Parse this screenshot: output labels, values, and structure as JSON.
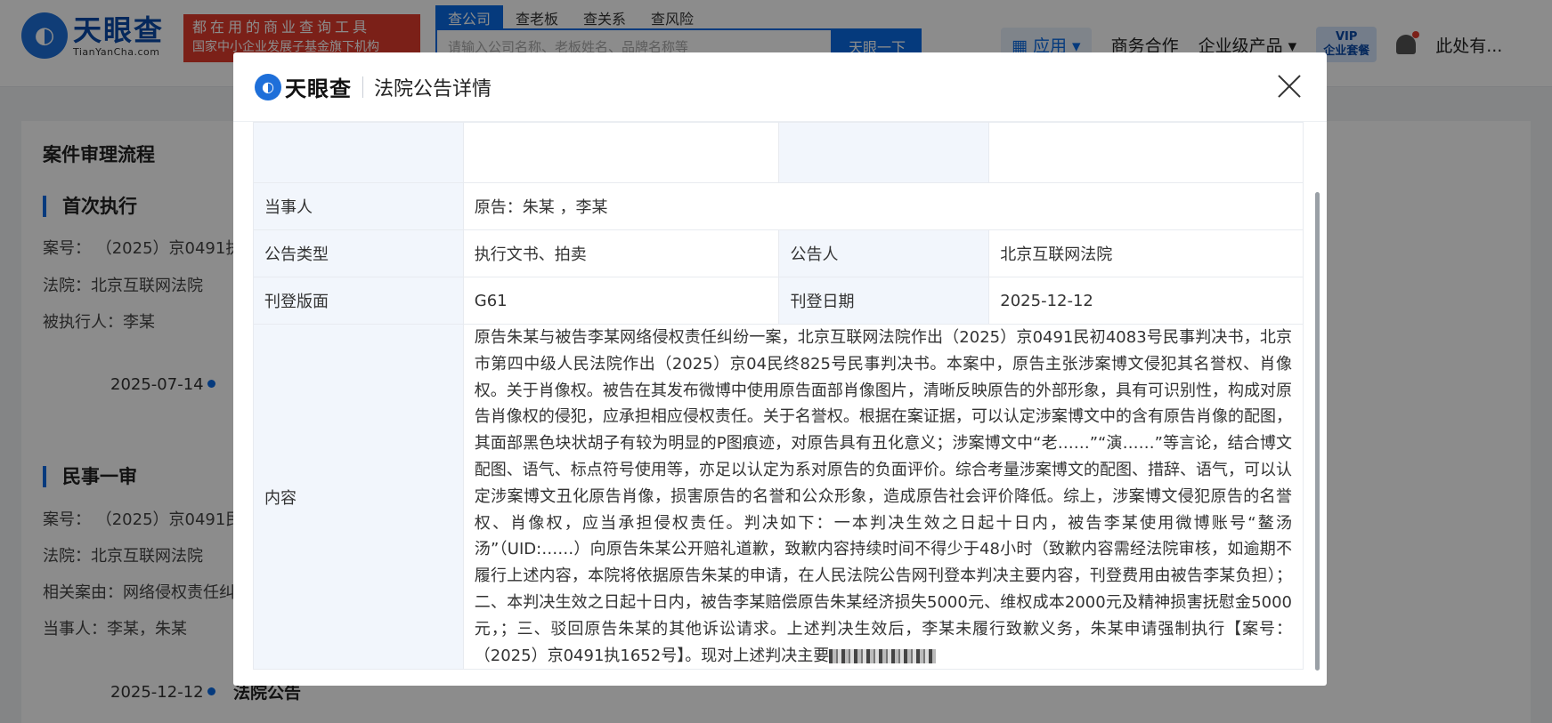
{
  "header": {
    "logo_cn": "天眼查",
    "logo_en": "TianYanCha.com",
    "slogan_line1": "都在用的商业查询工具",
    "slogan_line2": "国家中小企业发展子基金旗下机构",
    "search_tabs": [
      "查公司",
      "查老板",
      "查关系",
      "查风险"
    ],
    "search_placeholder": "请输入公司名称、老板姓名、品牌名称等",
    "search_button": "天眼一下",
    "nav": {
      "app": "应用",
      "business": "商务合作",
      "enterprise": "企业级产品",
      "vip_top": "VIP",
      "vip_bottom": "企业套餐",
      "user": "此处有..."
    }
  },
  "background": {
    "title": "案件审理流程",
    "section1": {
      "title": "首次执行",
      "case_no": "案号： （2025）京0491执",
      "court": "法院：北京互联网法院",
      "executed": "被执行人：李某",
      "date": "2025-07-14"
    },
    "section2": {
      "title": "民事一审",
      "case_no": "案号： （2025）京0491民",
      "court": "法院：北京互联网法院",
      "cause": "相关案由：网络侵权责任纠",
      "parties": "当事人：李某，朱某",
      "date": "2025-12-12",
      "tag": "法院公告"
    }
  },
  "modal": {
    "logo": "天眼查",
    "title": "法院公告详情",
    "rows": {
      "party_label": "当事人",
      "party_value": "原告：朱某 ，李某",
      "type_label": "公告类型",
      "type_value": "执行文书、拍卖",
      "announcer_label": "公告人",
      "announcer_value": "北京互联网法院",
      "page_label": "刊登版面",
      "page_value": "G61",
      "date_label": "刊登日期",
      "date_value": "2025-12-12",
      "content_label": "内容",
      "content_value": "原告朱某与被告李某网络侵权责任纠纷一案，北京互联网法院作出（2025）京0491民初4083号民事判决书，北京市第四中级人民法院作出（2025）京04民终825号民事判决书。本案中，原告主张涉案博文侵犯其名誉权、肖像权。关于肖像权。被告在其发布微博中使用原告面部肖像图片，清晰反映原告的外部形象，具有可识别性，构成对原告肖像权的侵犯，应承担相应侵权责任。关于名誉权。根据在案证据，可以认定涉案博文中的含有原告肖像的配图，其面部黑色块状胡子有较为明显的P图痕迹，对原告具有丑化意义；涉案博文中“老……”“演……”等言论，结合博文配图、语气、标点符号使用等，亦足以认定为系对原告的负面评价。综合考量涉案博文的配图、措辞、语气，可以认定涉案博文丑化原告肖像，损害原告的名誉和公众形象，造成原告社会评价降低。综上，涉案博文侵犯原告的名誉权、肖像权，应当承担侵权责任。判决如下：一本判决生效之日起十日内，被告李某使用微博账号“鳌汤汤”（UID:……）向原告朱某公开赔礼道歉，致歉内容持续时间不得少于48小时（致歉内容需经法院审核，如逾期不履行上述内容，本院将依据原告朱某的申请，在人民法院公告网刊登本判决主要内容，刊登费用由被告李某负担）；二、本判决生效之日起十日内，被告李某赔偿原告朱某经济损失5000元、维权成本2000元及精神损害抚慰金5000元，；三、驳回原告朱某的其他诉讼请求。上述判决生效后，李某未履行致歉义务，朱某申请强制执行【案号：（2025）京0491执1652号】。现对上述判决主要"
    }
  }
}
